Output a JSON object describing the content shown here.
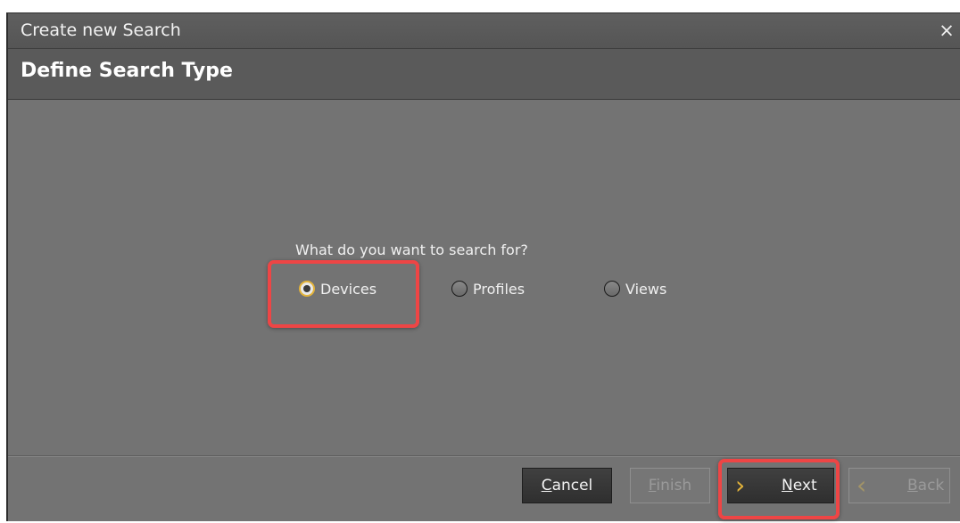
{
  "window": {
    "title": "Create new Search",
    "close_glyph": "×"
  },
  "header": {
    "title": "Define Search Type"
  },
  "main": {
    "question": "What do you want to search for?",
    "options": [
      {
        "label": "Devices",
        "selected": true
      },
      {
        "label": "Profiles",
        "selected": false
      },
      {
        "label": "Views",
        "selected": false
      }
    ]
  },
  "footer": {
    "cancel": {
      "label": "Cancel",
      "mnemonic": "C",
      "rest": "ancel"
    },
    "finish": {
      "label": "Finish",
      "mnemonic": "F",
      "rest": "inish",
      "disabled": true
    },
    "next": {
      "label": "Next",
      "mnemonic": "N",
      "rest": "ext",
      "icon": "chevron-right-icon"
    },
    "back": {
      "label": "Back",
      "mnemonic": "B",
      "rest": "ack",
      "disabled": true,
      "icon": "chevron-left-icon"
    }
  },
  "colors": {
    "dialog_bg": "#737373",
    "accent": "#e3b33a",
    "highlight": "#ee4545"
  }
}
